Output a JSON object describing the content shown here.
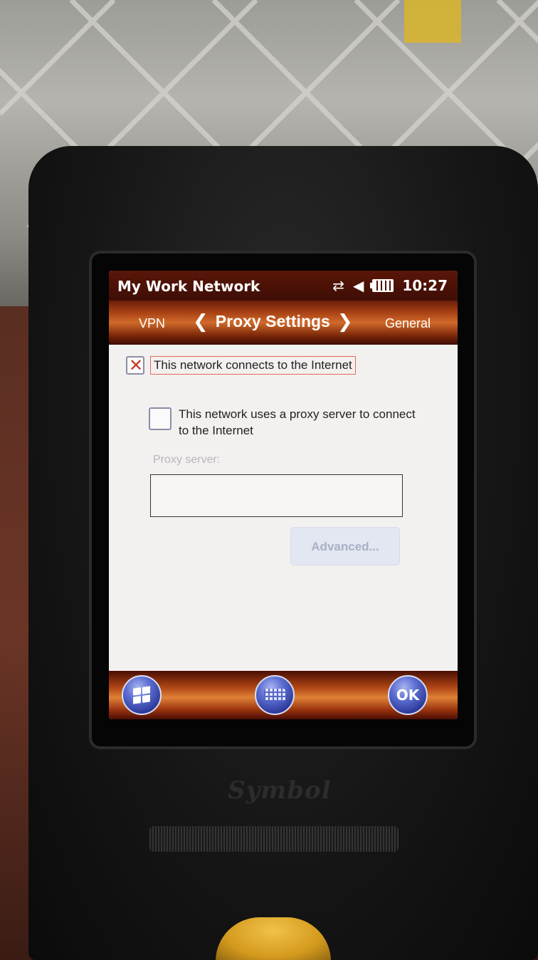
{
  "statusbar": {
    "app_title": "My Work Network",
    "time": "10:27",
    "icons": [
      "connectivity-icon",
      "volume-icon",
      "battery-icon"
    ]
  },
  "tabs": {
    "prev": "VPN",
    "current": "Proxy Settings",
    "next": "General"
  },
  "settings": {
    "connects_internet_label": "This network connects to the Internet",
    "connects_internet_checked": true,
    "uses_proxy_label": "This network uses a proxy server to connect to the Internet",
    "uses_proxy_checked": false,
    "proxy_server_label": "Proxy server:",
    "proxy_server_value": "",
    "advanced_button": "Advanced..."
  },
  "softkeys": {
    "start": "start-icon",
    "keyboard": "keyboard-icon",
    "ok": "OK"
  },
  "device": {
    "brand": "Symbol"
  },
  "colors": {
    "titlebar": "#4a1006",
    "accent": "#d16a2a",
    "checkmark": "#c43a26",
    "orb": "#4a5ac2"
  }
}
